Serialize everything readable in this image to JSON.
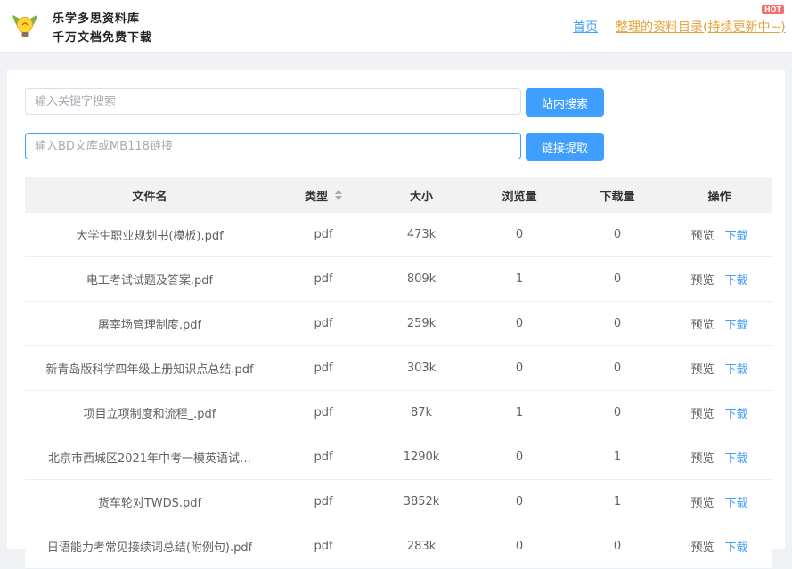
{
  "header": {
    "logo_line1": "乐学多思资料库",
    "logo_line2": "千万文档免费下载",
    "nav_home": "首页",
    "nav_catalog": "整理的资料目录(持续更新中~)",
    "hot_badge": "HOT"
  },
  "search": {
    "placeholder": "输入关键字搜索",
    "button": "站内搜索"
  },
  "link_extract": {
    "placeholder": "输入BD文库或MB118链接",
    "button": "链接提取"
  },
  "table": {
    "headers": [
      "文件名",
      "类型",
      "大小",
      "浏览量",
      "下载量",
      "操作"
    ],
    "rows": [
      {
        "name": "大学生职业规划书(模板).pdf",
        "type": "pdf",
        "size": "473k",
        "views": "0",
        "downloads": "0",
        "preview": "预览",
        "download": "下载"
      },
      {
        "name": "电工考试试题及答案.pdf",
        "type": "pdf",
        "size": "809k",
        "views": "1",
        "downloads": "0",
        "preview": "预览",
        "download": "下载"
      },
      {
        "name": "屠宰场管理制度.pdf",
        "type": "pdf",
        "size": "259k",
        "views": "0",
        "downloads": "0",
        "preview": "预览",
        "download": "下载"
      },
      {
        "name": "新青岛版科学四年级上册知识点总结.pdf",
        "type": "pdf",
        "size": "303k",
        "views": "0",
        "downloads": "0",
        "preview": "预览",
        "download": "下载"
      },
      {
        "name": "项目立项制度和流程_.pdf",
        "type": "pdf",
        "size": "87k",
        "views": "1",
        "downloads": "0",
        "preview": "预览",
        "download": "下载"
      },
      {
        "name": "北京市西城区2021年中考一模英语试…",
        "type": "pdf",
        "size": "1290k",
        "views": "0",
        "downloads": "1",
        "preview": "预览",
        "download": "下载"
      },
      {
        "name": "货车轮对TWDS.pdf",
        "type": "pdf",
        "size": "3852k",
        "views": "0",
        "downloads": "1",
        "preview": "预览",
        "download": "下载"
      },
      {
        "name": "日语能力考常见接续词总结(附例句).pdf",
        "type": "pdf",
        "size": "283k",
        "views": "0",
        "downloads": "0",
        "preview": "预览",
        "download": "下载"
      }
    ]
  },
  "colors": {
    "primary": "#409eff",
    "catalog_link": "#e6a23c",
    "hot_badge": "#f56c6c"
  },
  "icons": [
    "lightbulb-logo-icon",
    "sort-caret-icon"
  ]
}
